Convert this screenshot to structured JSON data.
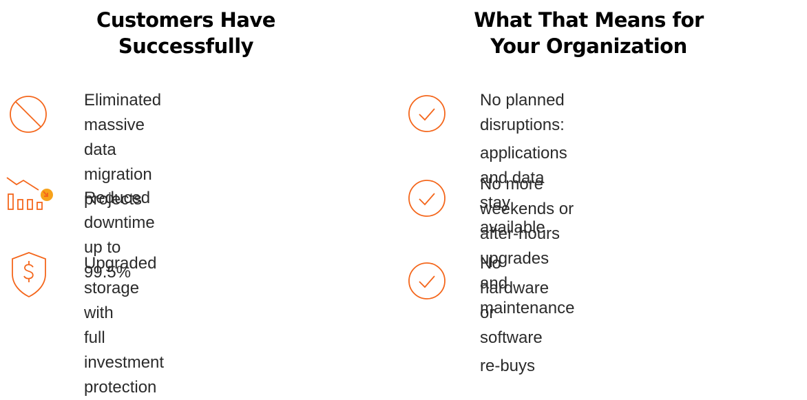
{
  "colors": {
    "accent": "#f4661b",
    "dot": "#f7a21b"
  },
  "left": {
    "title_line1": "Customers Have",
    "title_line2": "Successfully",
    "items": [
      {
        "icon": "prohibited-icon",
        "line1": "Eliminated massive data",
        "line2": "migration projects"
      },
      {
        "icon": "downtime-chart-icon",
        "line1": "Reduced downtime up to 99.5%",
        "line2": ""
      },
      {
        "icon": "dollar-shield-icon",
        "line1": "Upgraded storage with",
        "line2": "full investment protection"
      }
    ]
  },
  "right": {
    "title_line1": "What That Means for",
    "title_line2": "Your Organization",
    "items": [
      {
        "icon": "check-circle-icon",
        "line1": "No planned disruptions:",
        "line2": "applications and data stay available"
      },
      {
        "icon": "check-circle-icon",
        "line1": "No more weekends or after-hours",
        "line2": "upgrades and maintenance"
      },
      {
        "icon": "check-circle-icon",
        "line1": "No hardware or software",
        "line2": "re-buys"
      }
    ]
  }
}
